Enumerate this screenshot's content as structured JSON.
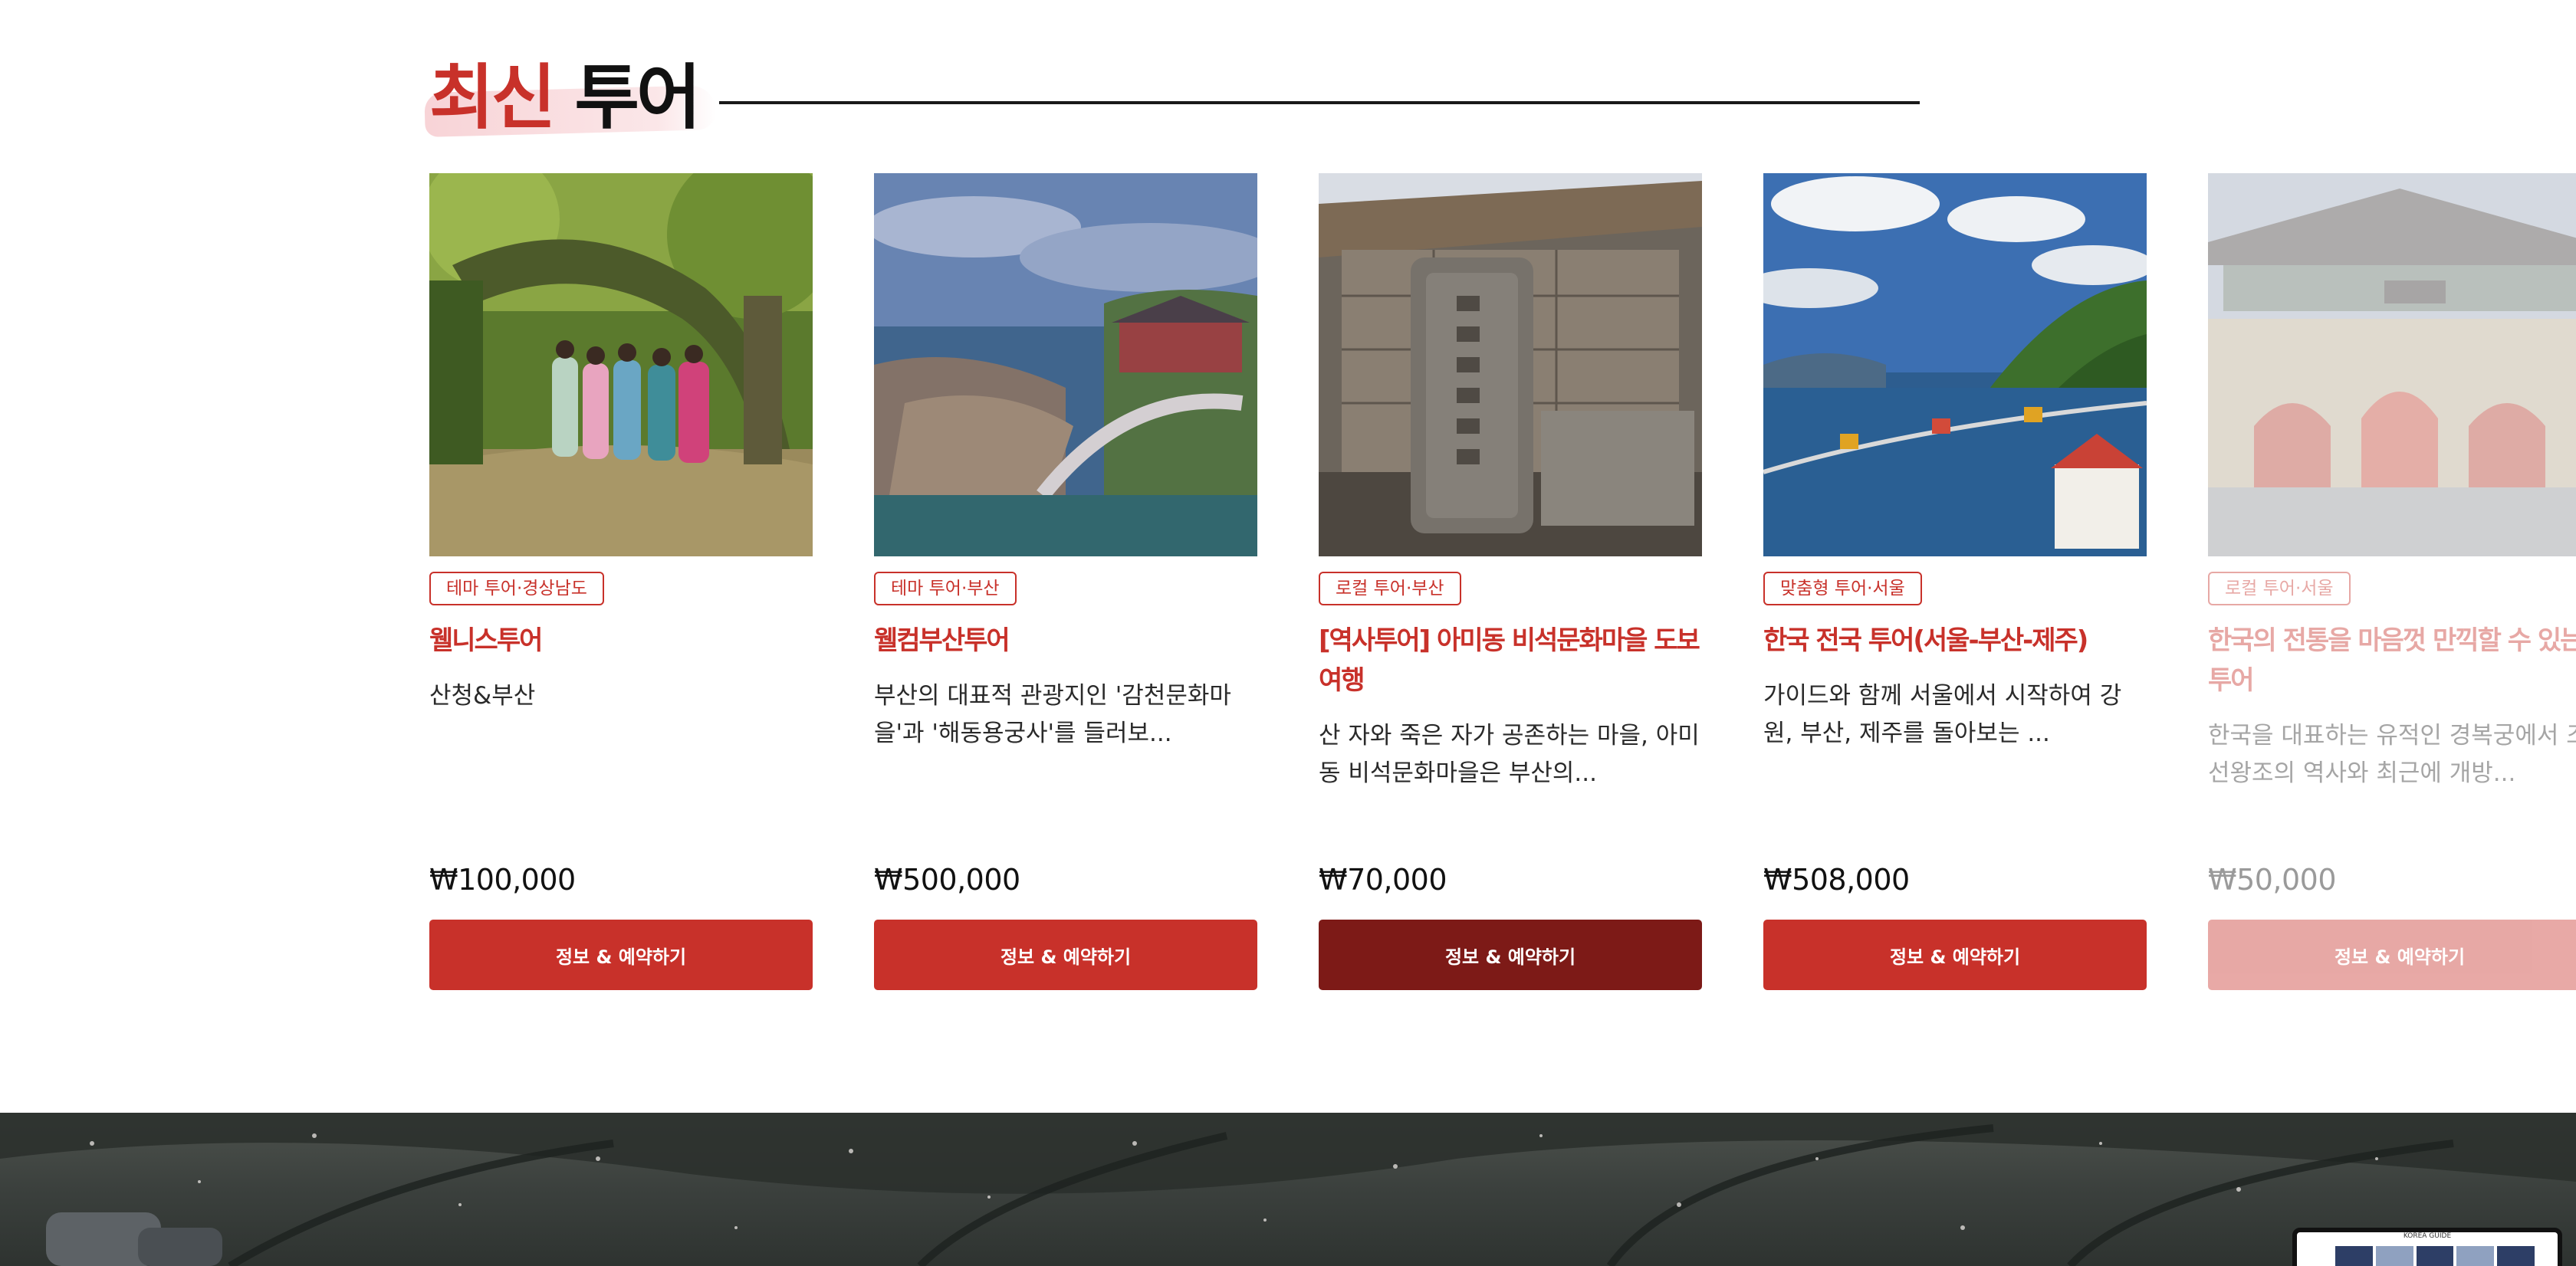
{
  "section": {
    "title_accent": "최신",
    "title_rest": "투어"
  },
  "tours": [
    {
      "tag": "테마 투어·경상남도",
      "title": "웰니스투어",
      "description": "산청&부산",
      "price": "₩100,000",
      "button": "정보 & 예약하기",
      "image_icon": "hanbok-tree-photo"
    },
    {
      "tag": "테마 투어·부산",
      "title": "웰컴부산투어",
      "description": "부산의 대표적 관광지인 '감천문화마을'과 '해동용궁사'를 들러보...",
      "price": "₩500,000",
      "button": "정보 & 예약하기",
      "image_icon": "coastal-temple-photo"
    },
    {
      "tag": "로컬 투어·부산",
      "title": "[역사투어] 아미동 비석문화마을 도보여행",
      "description": "산 자와 죽은 자가 공존하는 마을, 아미동 비석문화마을은 부산의...",
      "price": "₩70,000",
      "button": "정보 & 예약하기",
      "image_icon": "stone-monument-photo"
    },
    {
      "tag": "맞춤형 투어·서울",
      "title": "한국 전국 투어(서울-부산-제주)",
      "description": "가이드와 함께 서울에서 시작하여 강원, 부산, 제주를 돌아보는 ...",
      "price": "₩508,000",
      "button": "정보 & 예약하기",
      "image_icon": "sea-coast-photo"
    },
    {
      "tag": "로컬 투어·서울",
      "title": "한국의 전통을 마음껏 만끽할 수 있는 투어",
      "description": "한국을 대표하는 유적인 경복궁에서 조선왕조의 역사와 최근에 개방...",
      "price": "₩50,000",
      "button": "정보 & 예약하기",
      "image_icon": "palace-gate-photo"
    }
  ],
  "carousel": {
    "next_icon": "chevron-right-icon"
  },
  "banner": {
    "mini_screen_label": "KOREA GUIDE"
  },
  "colors": {
    "accent": "#c8312a",
    "button_active": "#7d1a17"
  }
}
